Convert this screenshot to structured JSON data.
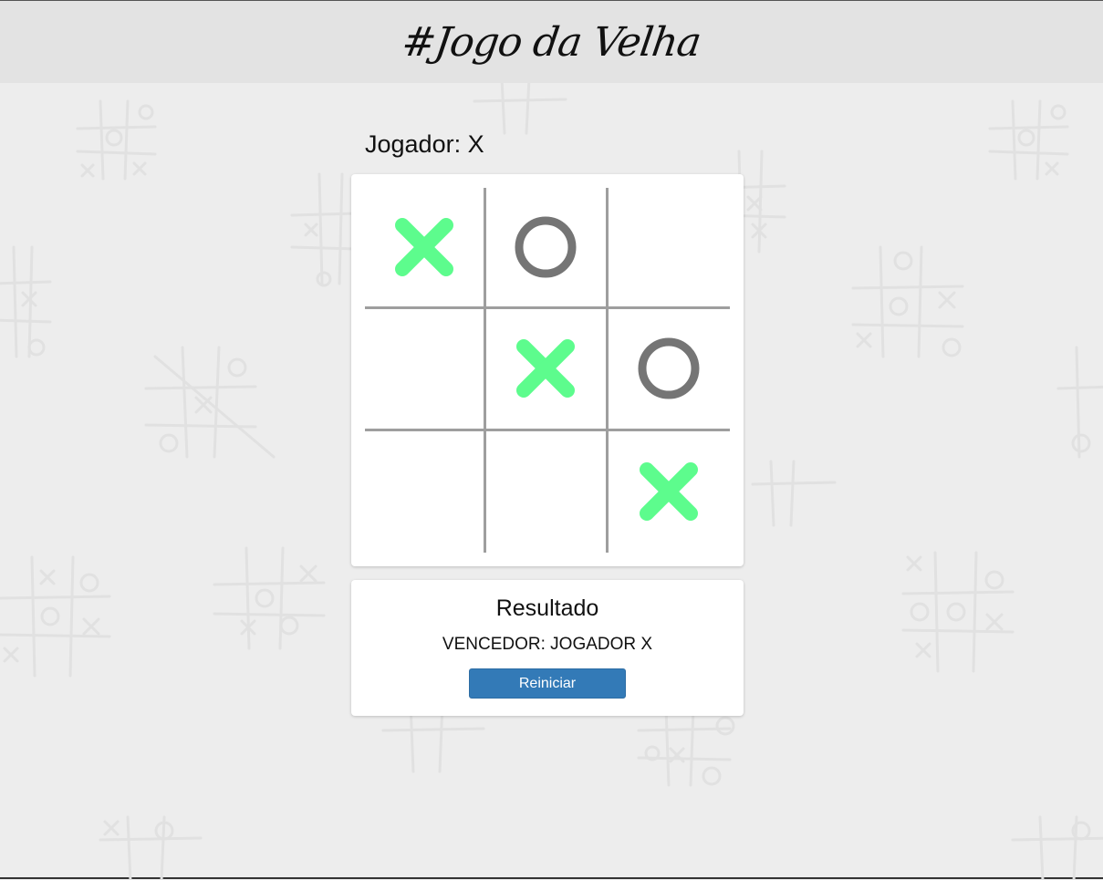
{
  "header": {
    "title": "#Jogo da Velha"
  },
  "status": {
    "player_label": "Jogador: X"
  },
  "board": {
    "cells": [
      "X",
      "O",
      "",
      "",
      "X",
      "O",
      "",
      "",
      "X"
    ]
  },
  "result": {
    "title": "Resultado",
    "winner_text": "VENCEDOR: JOGADOR X",
    "restart_label": "Reiniciar"
  },
  "colors": {
    "x_mark": "#5dfc8d",
    "o_mark": "#757575",
    "grid": "#9e9e9e",
    "button": "#337ab7"
  }
}
